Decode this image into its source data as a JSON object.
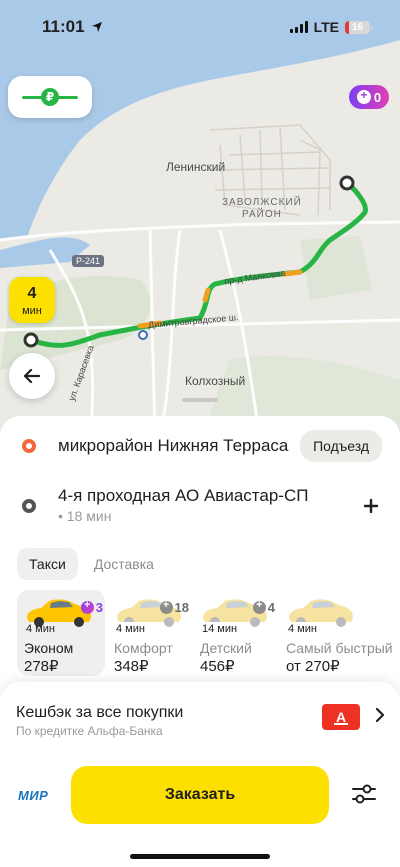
{
  "status_bar": {
    "time": "11:01",
    "network": "LTE",
    "battery": "16",
    "battery_level": 0.16
  },
  "map": {
    "labels": {
      "lenin": "Ленинский",
      "district_1": "ЗАВОЛЖСКИЙ",
      "district_2": "РАЙОН",
      "road_badge": "Р-241",
      "makeeva": "пр-д Маяковва",
      "dimitrov": "Димитровградское ш.",
      "kolhozny": "Колхозный",
      "krasny": "ул. Карасевка"
    },
    "eta_badge": {
      "value": "4",
      "unit": "мин"
    },
    "plus_points": "0",
    "payment_icon": "₽",
    "icons": {
      "back": "arrow-left-icon",
      "payment": "ruble-icon",
      "plus": "plus-points-icon"
    }
  },
  "route": {
    "from": {
      "address": "микрорайон Нижняя Терраса",
      "action": "Подъезд"
    },
    "to": {
      "address": "4-я проходная АО Авиастар-СП",
      "eta": "• 18 мин"
    },
    "add_stop_icon": "plus-icon"
  },
  "tabs": [
    {
      "label": "Такси",
      "active": true
    },
    {
      "label": "Доставка",
      "active": false
    }
  ],
  "tariffs": [
    {
      "name": "Эконом",
      "price": "278₽",
      "eta": "4 мин",
      "badge": "3",
      "badge_style": "purple",
      "selected": true
    },
    {
      "name": "Комфорт",
      "price": "348₽",
      "eta": "4 мин",
      "badge": "18",
      "badge_style": "gray",
      "selected": false
    },
    {
      "name": "Детский",
      "price": "456₽",
      "eta": "14 мин",
      "badge": "4",
      "badge_style": "gray",
      "selected": false
    },
    {
      "name": "Самый быстрый",
      "price": "от 270₽",
      "eta": "4 мин",
      "badge": "",
      "badge_style": "none",
      "selected": false
    }
  ],
  "cashback": {
    "title": "Кешбэк за все покупки",
    "subtitle": "По кредитке Альфа-Банка",
    "logo_letter": "А"
  },
  "order": {
    "payment_method": "МИР",
    "button_label": "Заказать",
    "settings_icon": "sliders-icon"
  },
  "colors": {
    "accent_yellow": "#fce000",
    "route_green": "#27b545",
    "origin_orange": "#f5663c",
    "alfa_red": "#ef3124"
  }
}
